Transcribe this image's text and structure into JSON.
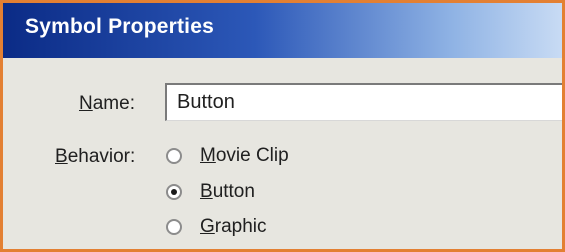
{
  "window": {
    "title": "Symbol Properties"
  },
  "form": {
    "name_label": "Name:",
    "name_label_access": "N",
    "name_label_rest": "ame:",
    "name_value": "Button",
    "behavior_label": "Behavior:",
    "behavior_label_access": "B",
    "behavior_label_rest": "ehavior:",
    "behavior_options": [
      {
        "label": "Movie Clip",
        "access": "M",
        "rest": "ovie Clip",
        "checked": false
      },
      {
        "label": "Button",
        "access": "B",
        "rest": "utton",
        "checked": true
      },
      {
        "label": "Graphic",
        "access": "G",
        "rest": "raphic",
        "checked": false
      }
    ],
    "selected_behavior": "Button"
  },
  "colors": {
    "frame_border": "#e38033",
    "titlebar_start": "#0b2b86",
    "titlebar_end": "#c8dbf4",
    "dialog_bg": "#e7e6e0"
  }
}
